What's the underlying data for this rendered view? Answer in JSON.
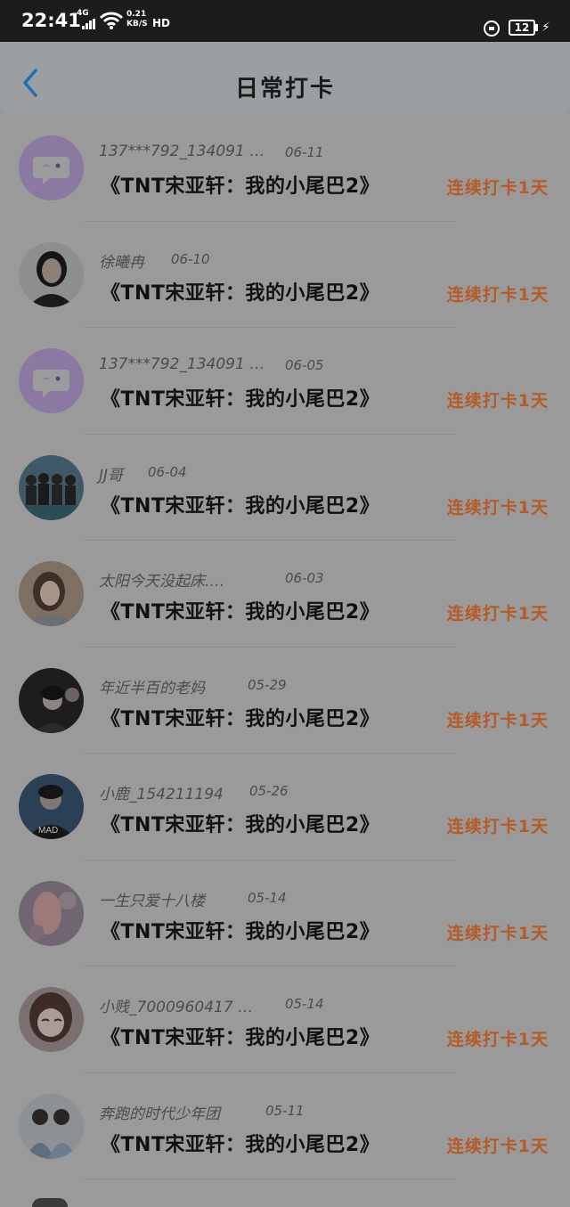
{
  "status_bar": {
    "time": "22:41",
    "network": "4G",
    "speed_value": "0.21",
    "speed_unit": "KB/S",
    "hd": "HD",
    "battery": "12"
  },
  "header": {
    "title": "日常打卡",
    "back_icon": "chevron-left-icon"
  },
  "checkins": [
    {
      "name": "137***792_134091 …",
      "date": "06-11",
      "title": "《TNT宋亚轩：我的小尾巴2》",
      "streak": "连续打卡1天",
      "avatar": "chat-bubble-icon"
    },
    {
      "name": "徐曦冉",
      "date": "06-10",
      "title": "《TNT宋亚轩：我的小尾巴2》",
      "streak": "连续打卡1天",
      "avatar": "user-photo"
    },
    {
      "name": "137***792_134091 …",
      "date": "06-05",
      "title": "《TNT宋亚轩：我的小尾巴2》",
      "streak": "连续打卡1天",
      "avatar": "chat-bubble-icon"
    },
    {
      "name": "JJ哥",
      "date": "06-04",
      "title": "《TNT宋亚轩：我的小尾巴2》",
      "streak": "连续打卡1天",
      "avatar": "group-photo"
    },
    {
      "name": "太阳今天没起床.…",
      "date": "06-03",
      "title": "《TNT宋亚轩：我的小尾巴2》",
      "streak": "连续打卡1天",
      "avatar": "user-photo"
    },
    {
      "name": "年近半百的老妈",
      "date": "05-29",
      "title": "《TNT宋亚轩：我的小尾巴2》",
      "streak": "连续打卡1天",
      "avatar": "user-photo"
    },
    {
      "name": "小鹿_154211194",
      "date": "05-26",
      "title": "《TNT宋亚轩：我的小尾巴2》",
      "streak": "连续打卡1天",
      "avatar": "user-photo"
    },
    {
      "name": "一生只爱十八楼",
      "date": "05-14",
      "title": "《TNT宋亚轩：我的小尾巴2》",
      "streak": "连续打卡1天",
      "avatar": "user-photo"
    },
    {
      "name": "小贱_7000960417 …",
      "date": "05-14",
      "title": "《TNT宋亚轩：我的小尾巴2》",
      "streak": "连续打卡1天",
      "avatar": "user-photo"
    },
    {
      "name": "奔跑的时代少年团",
      "date": "05-11",
      "title": "《TNT宋亚轩：我的小尾巴2》",
      "streak": "连续打卡1天",
      "avatar": "user-photo"
    }
  ],
  "colors": {
    "accent": "#1e88e5",
    "streak": "#b65a26",
    "placeholder_avatar": "#8a7aa1"
  }
}
